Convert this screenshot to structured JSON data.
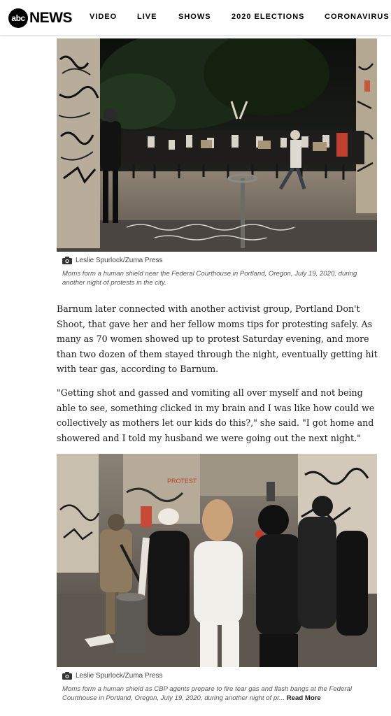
{
  "header": {
    "logo_mark": "abc",
    "logo_word": "NEWS",
    "nav": [
      "VIDEO",
      "LIVE",
      "SHOWS",
      "2020 ELECTIONS",
      "CORONAVIRUS"
    ]
  },
  "photo1": {
    "credit": "Leslie Spurlock/Zuma Press",
    "caption": "Moms form a human shield near the Federal Courthouse in Portland, Oregon, July 19, 2020, during another night of protests in the city."
  },
  "body": {
    "paragraph1": "Barnum later connected with another activist group, Portland Don't Shoot, that gave her and her fellow moms tips for protesting safely. As many as 70 women showed up to protest Saturday evening, and more than two dozen of them stayed through the night, eventually getting hit with tear gas, according to Barnum.",
    "paragraph2": "\"Getting shot and gassed and vomiting all over myself and not being able to see, something clicked in my brain and I was like how could we collectively as mothers let our kids do this?,\" she said. \"I got home and showered and I told my husband we were going out the next night.\""
  },
  "photo2": {
    "credit": "Leslie Spurlock/Zuma Press",
    "caption": "Moms form a human shield as CBP agents prepare to fire tear gas and flash bangs at the Federal Courthouse in Portland, Oregon, July 19, 2020, during another night of pr...",
    "read_more": "Read More"
  },
  "colors": {
    "nav_text": "#000000",
    "caption_text": "#555555",
    "body_text": "#1a1a1a"
  }
}
